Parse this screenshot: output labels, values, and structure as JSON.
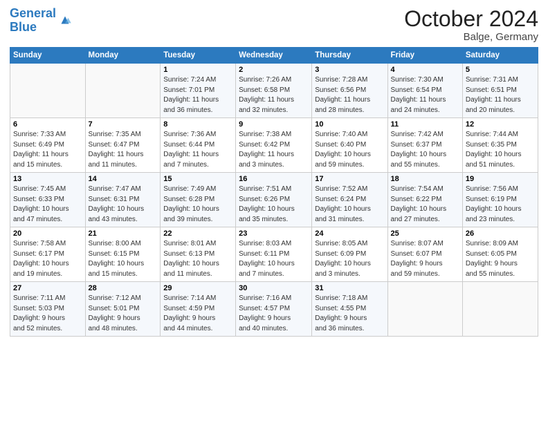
{
  "header": {
    "logo_line1": "General",
    "logo_line2": "Blue",
    "month_title": "October 2024",
    "location": "Balge, Germany"
  },
  "weekdays": [
    "Sunday",
    "Monday",
    "Tuesday",
    "Wednesday",
    "Thursday",
    "Friday",
    "Saturday"
  ],
  "weeks": [
    [
      {
        "day": "",
        "info": ""
      },
      {
        "day": "",
        "info": ""
      },
      {
        "day": "1",
        "info": "Sunrise: 7:24 AM\nSunset: 7:01 PM\nDaylight: 11 hours\nand 36 minutes."
      },
      {
        "day": "2",
        "info": "Sunrise: 7:26 AM\nSunset: 6:58 PM\nDaylight: 11 hours\nand 32 minutes."
      },
      {
        "day": "3",
        "info": "Sunrise: 7:28 AM\nSunset: 6:56 PM\nDaylight: 11 hours\nand 28 minutes."
      },
      {
        "day": "4",
        "info": "Sunrise: 7:30 AM\nSunset: 6:54 PM\nDaylight: 11 hours\nand 24 minutes."
      },
      {
        "day": "5",
        "info": "Sunrise: 7:31 AM\nSunset: 6:51 PM\nDaylight: 11 hours\nand 20 minutes."
      }
    ],
    [
      {
        "day": "6",
        "info": "Sunrise: 7:33 AM\nSunset: 6:49 PM\nDaylight: 11 hours\nand 15 minutes."
      },
      {
        "day": "7",
        "info": "Sunrise: 7:35 AM\nSunset: 6:47 PM\nDaylight: 11 hours\nand 11 minutes."
      },
      {
        "day": "8",
        "info": "Sunrise: 7:36 AM\nSunset: 6:44 PM\nDaylight: 11 hours\nand 7 minutes."
      },
      {
        "day": "9",
        "info": "Sunrise: 7:38 AM\nSunset: 6:42 PM\nDaylight: 11 hours\nand 3 minutes."
      },
      {
        "day": "10",
        "info": "Sunrise: 7:40 AM\nSunset: 6:40 PM\nDaylight: 10 hours\nand 59 minutes."
      },
      {
        "day": "11",
        "info": "Sunrise: 7:42 AM\nSunset: 6:37 PM\nDaylight: 10 hours\nand 55 minutes."
      },
      {
        "day": "12",
        "info": "Sunrise: 7:44 AM\nSunset: 6:35 PM\nDaylight: 10 hours\nand 51 minutes."
      }
    ],
    [
      {
        "day": "13",
        "info": "Sunrise: 7:45 AM\nSunset: 6:33 PM\nDaylight: 10 hours\nand 47 minutes."
      },
      {
        "day": "14",
        "info": "Sunrise: 7:47 AM\nSunset: 6:31 PM\nDaylight: 10 hours\nand 43 minutes."
      },
      {
        "day": "15",
        "info": "Sunrise: 7:49 AM\nSunset: 6:28 PM\nDaylight: 10 hours\nand 39 minutes."
      },
      {
        "day": "16",
        "info": "Sunrise: 7:51 AM\nSunset: 6:26 PM\nDaylight: 10 hours\nand 35 minutes."
      },
      {
        "day": "17",
        "info": "Sunrise: 7:52 AM\nSunset: 6:24 PM\nDaylight: 10 hours\nand 31 minutes."
      },
      {
        "day": "18",
        "info": "Sunrise: 7:54 AM\nSunset: 6:22 PM\nDaylight: 10 hours\nand 27 minutes."
      },
      {
        "day": "19",
        "info": "Sunrise: 7:56 AM\nSunset: 6:19 PM\nDaylight: 10 hours\nand 23 minutes."
      }
    ],
    [
      {
        "day": "20",
        "info": "Sunrise: 7:58 AM\nSunset: 6:17 PM\nDaylight: 10 hours\nand 19 minutes."
      },
      {
        "day": "21",
        "info": "Sunrise: 8:00 AM\nSunset: 6:15 PM\nDaylight: 10 hours\nand 15 minutes."
      },
      {
        "day": "22",
        "info": "Sunrise: 8:01 AM\nSunset: 6:13 PM\nDaylight: 10 hours\nand 11 minutes."
      },
      {
        "day": "23",
        "info": "Sunrise: 8:03 AM\nSunset: 6:11 PM\nDaylight: 10 hours\nand 7 minutes."
      },
      {
        "day": "24",
        "info": "Sunrise: 8:05 AM\nSunset: 6:09 PM\nDaylight: 10 hours\nand 3 minutes."
      },
      {
        "day": "25",
        "info": "Sunrise: 8:07 AM\nSunset: 6:07 PM\nDaylight: 9 hours\nand 59 minutes."
      },
      {
        "day": "26",
        "info": "Sunrise: 8:09 AM\nSunset: 6:05 PM\nDaylight: 9 hours\nand 55 minutes."
      }
    ],
    [
      {
        "day": "27",
        "info": "Sunrise: 7:11 AM\nSunset: 5:03 PM\nDaylight: 9 hours\nand 52 minutes."
      },
      {
        "day": "28",
        "info": "Sunrise: 7:12 AM\nSunset: 5:01 PM\nDaylight: 9 hours\nand 48 minutes."
      },
      {
        "day": "29",
        "info": "Sunrise: 7:14 AM\nSunset: 4:59 PM\nDaylight: 9 hours\nand 44 minutes."
      },
      {
        "day": "30",
        "info": "Sunrise: 7:16 AM\nSunset: 4:57 PM\nDaylight: 9 hours\nand 40 minutes."
      },
      {
        "day": "31",
        "info": "Sunrise: 7:18 AM\nSunset: 4:55 PM\nDaylight: 9 hours\nand 36 minutes."
      },
      {
        "day": "",
        "info": ""
      },
      {
        "day": "",
        "info": ""
      }
    ]
  ]
}
